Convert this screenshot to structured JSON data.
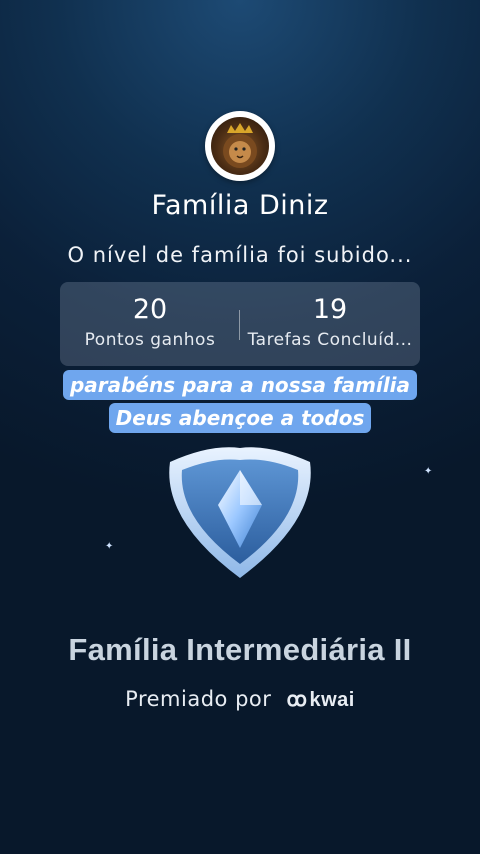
{
  "profile": {
    "avatar_icon": "lion-crown-icon",
    "family_name": "Família Diniz"
  },
  "level_message": "O nível de família foi subido...",
  "stats": [
    {
      "value": "20",
      "label": "Pontos ganhos"
    },
    {
      "value": "19",
      "label": "Tarefas Concluíd..."
    }
  ],
  "captions": {
    "line1": "parabéns para a nossa família",
    "line2": "Deus abençoe a todos"
  },
  "badge": {
    "icon": "diamond-shield-icon",
    "title": "Família Intermediária II"
  },
  "awarded_by": {
    "prefix": "Premiado por",
    "brand": "kwai",
    "brand_icon": "kwai-logo-icon"
  },
  "colors": {
    "caption_bg": "#6fa6ee",
    "title_text": "#c9d4df",
    "background_top": "#1d4a74",
    "background_bottom": "#08182b"
  }
}
